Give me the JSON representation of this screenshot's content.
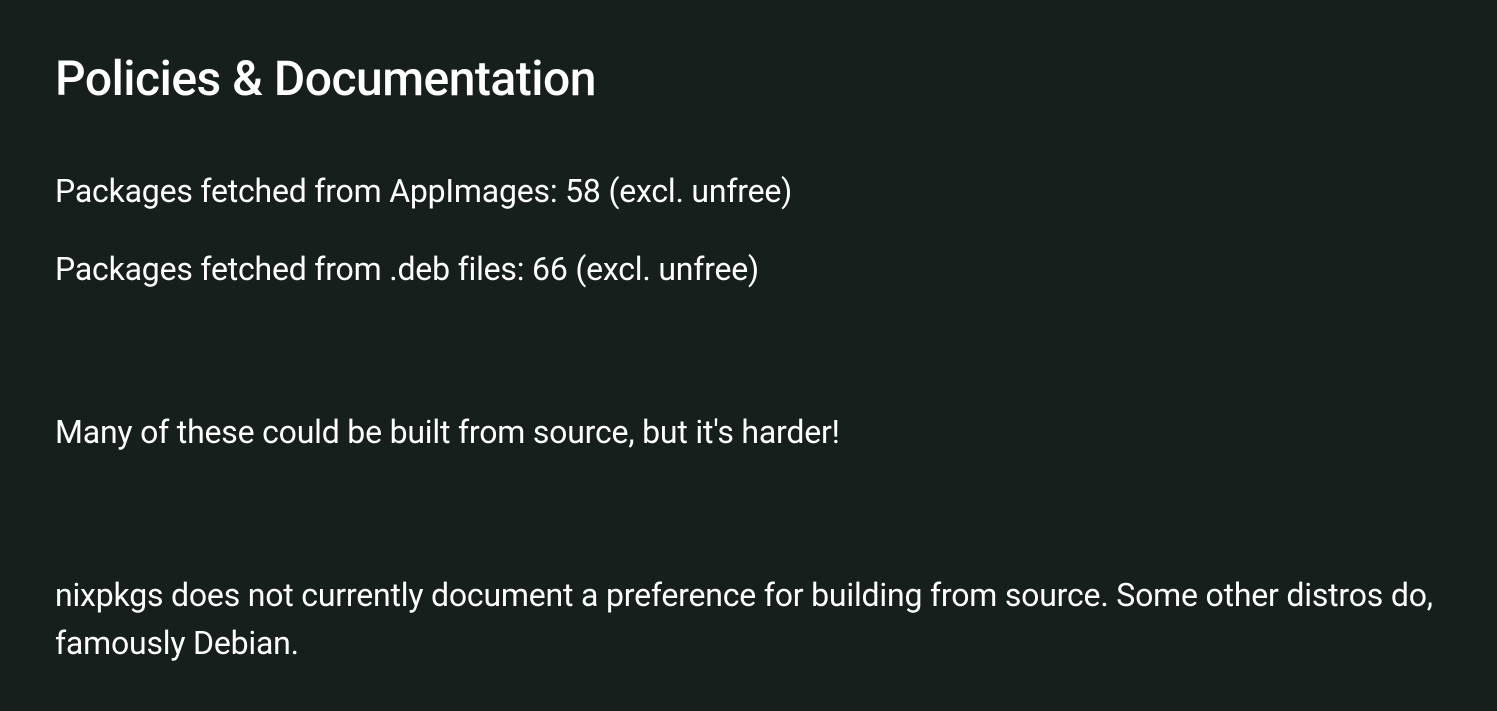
{
  "slide": {
    "title": "Policies & Documentation",
    "line1": "Packages fetched from AppImages: 58 (excl. unfree)",
    "line2": "Packages fetched from .deb files: 66 (excl. unfree)",
    "line3": "Many of these could be built from source, but it's harder!",
    "line4": "nixpkgs does not currently document a preference for building from source. Some other distros do, famously Debian."
  }
}
